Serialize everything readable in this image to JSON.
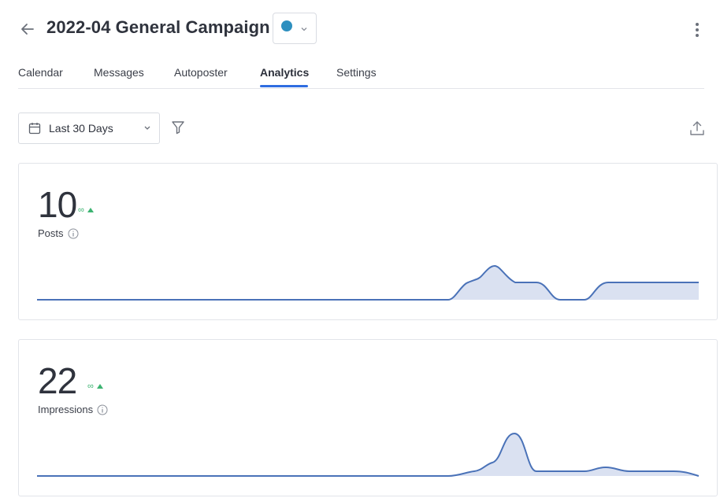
{
  "header": {
    "title": "2022-04 General Campaign",
    "color_accent": "#2d8fbf"
  },
  "tabs": [
    {
      "label": "Calendar",
      "active": false
    },
    {
      "label": "Messages",
      "active": false
    },
    {
      "label": "Autoposter",
      "active": false
    },
    {
      "label": "Analytics",
      "active": true
    },
    {
      "label": "Settings",
      "active": false
    }
  ],
  "toolbar": {
    "date_range": "Last 30 Days"
  },
  "cards": {
    "posts": {
      "value": "10",
      "change": "∞",
      "label": "Posts"
    },
    "impressions": {
      "value": "22",
      "change": "∞",
      "label": "Impressions"
    }
  },
  "colors": {
    "accent": "#2f6de1",
    "spark_line": "#4a72b8",
    "spark_fill": "#cfd9ec",
    "positive": "#3cb371"
  }
}
